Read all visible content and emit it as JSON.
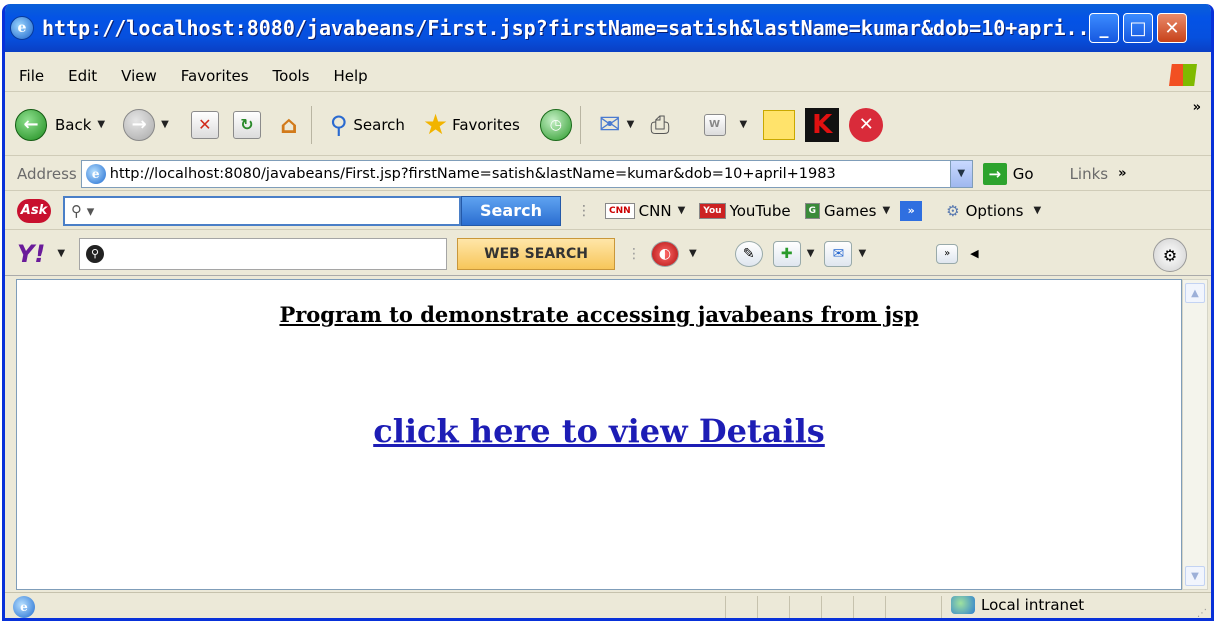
{
  "window": {
    "title": "http://localhost:8080/javabeans/First.jsp?firstName=satish&lastName=kumar&dob=10+apri...",
    "minimize": "_",
    "maximize": "□",
    "close": "✕"
  },
  "menu": [
    "File",
    "Edit",
    "View",
    "Favorites",
    "Tools",
    "Help"
  ],
  "toolbar": {
    "back_label": "Back",
    "search_label": "Search",
    "favorites_label": "Favorites",
    "overflow": "»"
  },
  "address": {
    "label": "Address",
    "url": "http://localhost:8080/javabeans/First.jsp?firstName=satish&lastName=kumar&dob=10+april+1983",
    "go_label": "Go",
    "links_label": "Links"
  },
  "ask_toolbar": {
    "logo": "Ask",
    "search_button": "Search",
    "links": [
      {
        "badge": "CNN",
        "label": "CNN"
      },
      {
        "badge": "You",
        "label": "YouTube"
      },
      {
        "badge": "G",
        "label": "Games"
      }
    ],
    "options_label": "Options"
  },
  "yahoo_toolbar": {
    "logo": "Y!",
    "search_button": "WEB SEARCH"
  },
  "page": {
    "heading": "Program to demonstrate accessing javabeans from jsp",
    "link_text": "click here to view Details"
  },
  "status": {
    "zone": "Local intranet"
  }
}
